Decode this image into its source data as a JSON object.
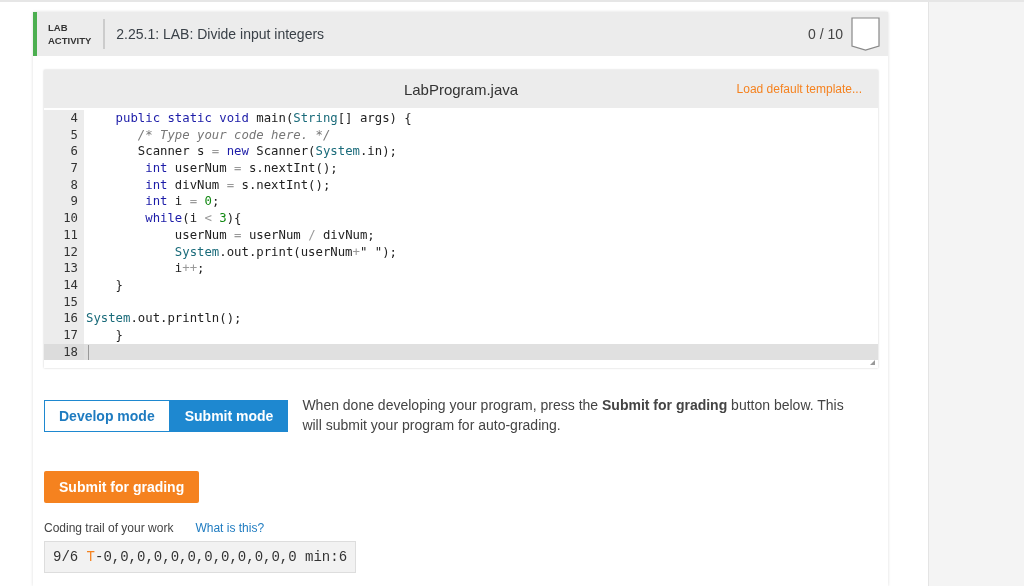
{
  "activity": {
    "label_line_1": "LAB",
    "label_line_2": "ACTIVITY",
    "title": "2.25.1: LAB: Divide input integers",
    "score": "0 / 10"
  },
  "editor": {
    "filename": "LabProgram.java",
    "template_link": "Load default template...",
    "lines": [
      {
        "number": "4",
        "current": false,
        "tokens": [
          {
            "kind": "keyword",
            "text": "    public static void"
          },
          {
            "kind": "plain",
            "text": " main("
          },
          {
            "kind": "builtin",
            "text": "String"
          },
          {
            "kind": "plain",
            "text": "[] args) {"
          }
        ]
      },
      {
        "number": "5",
        "current": false,
        "tokens": [
          {
            "kind": "comment",
            "text": "       /* Type your code here. */"
          }
        ]
      },
      {
        "number": "6",
        "current": false,
        "tokens": [
          {
            "kind": "plain",
            "text": "       Scanner s "
          },
          {
            "kind": "operator",
            "text": "="
          },
          {
            "kind": "keyword",
            "text": " new"
          },
          {
            "kind": "plain",
            "text": " Scanner("
          },
          {
            "kind": "builtin",
            "text": "System"
          },
          {
            "kind": "plain",
            "text": ".in);"
          }
        ]
      },
      {
        "number": "7",
        "current": false,
        "tokens": [
          {
            "kind": "keyword",
            "text": "        int"
          },
          {
            "kind": "plain",
            "text": " userNum "
          },
          {
            "kind": "operator",
            "text": "="
          },
          {
            "kind": "plain",
            "text": " s.nextInt();"
          }
        ]
      },
      {
        "number": "8",
        "current": false,
        "tokens": [
          {
            "kind": "keyword",
            "text": "        int"
          },
          {
            "kind": "plain",
            "text": " divNum "
          },
          {
            "kind": "operator",
            "text": "="
          },
          {
            "kind": "plain",
            "text": " s.nextInt();"
          }
        ]
      },
      {
        "number": "9",
        "current": false,
        "tokens": [
          {
            "kind": "keyword",
            "text": "        int"
          },
          {
            "kind": "plain",
            "text": " i "
          },
          {
            "kind": "operator",
            "text": "="
          },
          {
            "kind": "number",
            "text": " 0"
          },
          {
            "kind": "plain",
            "text": ";"
          }
        ]
      },
      {
        "number": "10",
        "current": false,
        "tokens": [
          {
            "kind": "keyword",
            "text": "        while"
          },
          {
            "kind": "plain",
            "text": "(i "
          },
          {
            "kind": "operator",
            "text": "<"
          },
          {
            "kind": "number",
            "text": " 3"
          },
          {
            "kind": "plain",
            "text": "){"
          }
        ]
      },
      {
        "number": "11",
        "current": false,
        "tokens": [
          {
            "kind": "plain",
            "text": "            userNum "
          },
          {
            "kind": "operator",
            "text": "="
          },
          {
            "kind": "plain",
            "text": " userNum "
          },
          {
            "kind": "operator",
            "text": "/"
          },
          {
            "kind": "plain",
            "text": " divNum;"
          }
        ]
      },
      {
        "number": "12",
        "current": false,
        "tokens": [
          {
            "kind": "builtin",
            "text": "            System"
          },
          {
            "kind": "plain",
            "text": ".out.print(userNum"
          },
          {
            "kind": "operator",
            "text": "+"
          },
          {
            "kind": "plain",
            "text": "\" \");"
          }
        ]
      },
      {
        "number": "13",
        "current": false,
        "tokens": [
          {
            "kind": "plain",
            "text": "            i"
          },
          {
            "kind": "operator",
            "text": "++"
          },
          {
            "kind": "plain",
            "text": ";"
          }
        ]
      },
      {
        "number": "14",
        "current": false,
        "tokens": [
          {
            "kind": "plain",
            "text": "    }"
          }
        ]
      },
      {
        "number": "15",
        "current": false
      },
      {
        "number": "16",
        "current": false,
        "tokens": [
          {
            "kind": "builtin",
            "text": "System"
          },
          {
            "kind": "plain",
            "text": ".out.println();"
          }
        ]
      },
      {
        "number": "17",
        "current": false,
        "tokens": [
          {
            "kind": "plain",
            "text": "    }"
          }
        ]
      },
      {
        "number": "18",
        "current": true
      }
    ]
  },
  "modes": [
    {
      "label": "Develop mode",
      "selected": false
    },
    {
      "label": "Submit mode",
      "selected": true
    }
  ],
  "instructions": "When done developing your program, press the **Submit for grading** button below. This will submit your program for auto-grading.",
  "submit_button": "Submit for grading",
  "trail": {
    "label": "Coding trail of your work",
    "link": "What is this?",
    "prefix": "9/6 ",
    "marker": "T",
    "values": "-0,0,0,0,0,0,0,0,0,0,0,0 min:6"
  }
}
